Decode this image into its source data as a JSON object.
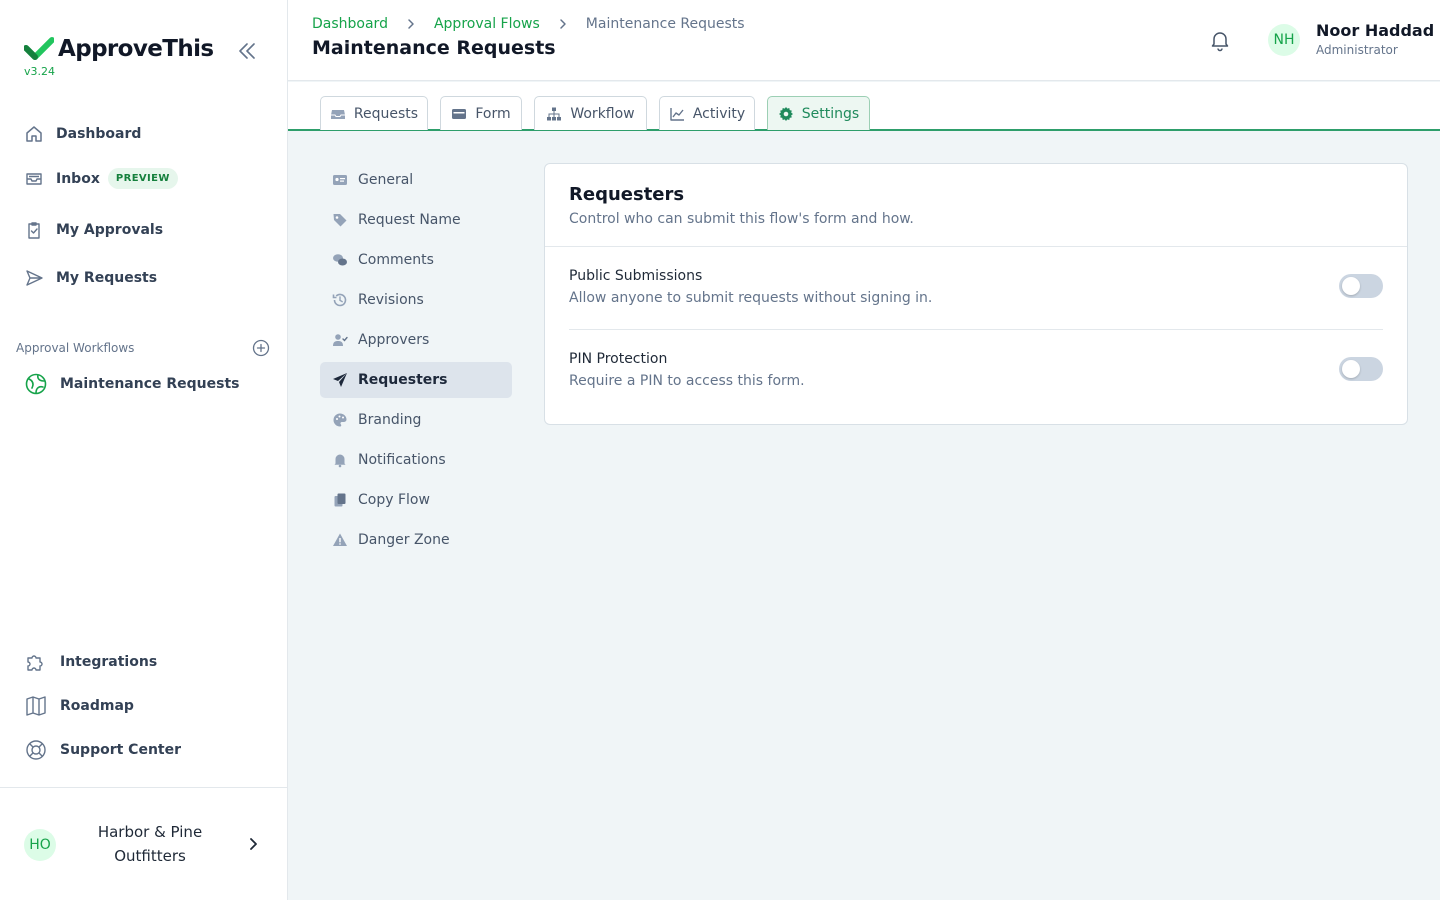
{
  "app": {
    "name": "ApproveThis",
    "version": "v3.24"
  },
  "sidebar": {
    "nav": [
      {
        "label": "Dashboard",
        "icon": "home-icon"
      },
      {
        "label": "Inbox",
        "icon": "inbox-icon",
        "badge": "PREVIEW"
      },
      {
        "label": "My Approvals",
        "icon": "clipboard-check-icon"
      },
      {
        "label": "My Requests",
        "icon": "send-icon"
      }
    ],
    "workflows_header": "Approval Workflows",
    "workflows": [
      {
        "label": "Maintenance Requests",
        "icon": "workflow-globe-icon"
      }
    ],
    "footer": [
      {
        "label": "Integrations",
        "icon": "puzzle-icon"
      },
      {
        "label": "Roadmap",
        "icon": "map-icon"
      },
      {
        "label": "Support Center",
        "icon": "lifebuoy-icon"
      }
    ],
    "org": {
      "initials": "HO",
      "name": "Harbor & Pine Outfitters"
    }
  },
  "header": {
    "breadcrumbs": [
      "Dashboard",
      "Approval Flows",
      "Maintenance Requests"
    ],
    "title": "Maintenance Requests",
    "user": {
      "initials": "NH",
      "name": "Noor Haddad",
      "role": "Administrator"
    }
  },
  "tabs": [
    {
      "label": "Requests",
      "icon": "inbox-tray-icon"
    },
    {
      "label": "Form",
      "icon": "form-icon"
    },
    {
      "label": "Workflow",
      "icon": "hierarchy-icon"
    },
    {
      "label": "Activity",
      "icon": "chart-line-icon"
    },
    {
      "label": "Settings",
      "icon": "gear-icon",
      "active": true
    }
  ],
  "settings_menu": [
    {
      "label": "General",
      "icon": "id-card-icon"
    },
    {
      "label": "Request Name",
      "icon": "tag-icon"
    },
    {
      "label": "Comments",
      "icon": "comments-icon"
    },
    {
      "label": "Revisions",
      "icon": "history-icon"
    },
    {
      "label": "Approvers",
      "icon": "user-check-icon"
    },
    {
      "label": "Requesters",
      "icon": "paper-plane-icon",
      "active": true
    },
    {
      "label": "Branding",
      "icon": "palette-icon"
    },
    {
      "label": "Notifications",
      "icon": "bell-icon"
    },
    {
      "label": "Copy Flow",
      "icon": "copy-icon"
    },
    {
      "label": "Danger Zone",
      "icon": "warning-icon"
    }
  ],
  "card": {
    "title": "Requesters",
    "subtitle": "Control who can submit this flow's form and how.",
    "rows": [
      {
        "title": "Public Submissions",
        "description": "Allow anyone to submit requests without signing in.",
        "enabled": false
      },
      {
        "title": "PIN Protection",
        "description": "Require a PIN to access this form.",
        "enabled": false
      }
    ]
  },
  "colors": {
    "accent": "#16a34a",
    "tab_underline": "#2e9e6b",
    "toggle_off": "#cbd5e1"
  }
}
